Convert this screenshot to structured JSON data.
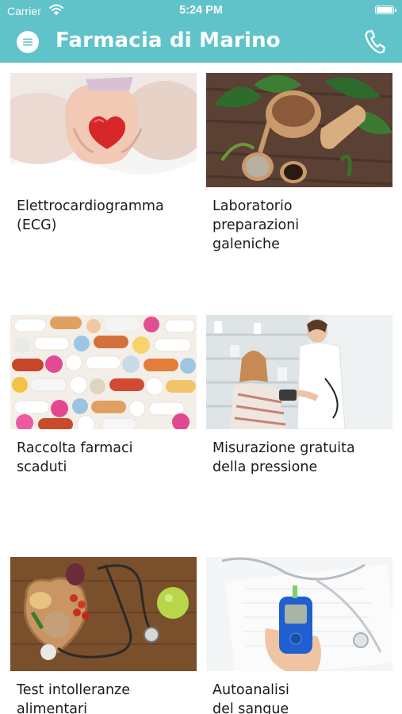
{
  "status_bar": {
    "carrier": "Carrier",
    "time": "5:24 PM",
    "wifi_icon": "wifi-icon",
    "battery_icon": "battery-icon"
  },
  "header": {
    "title": "Farmacia di Marino",
    "menu_icon": "menu-icon",
    "phone_icon": "phone-icon",
    "background": "#5fc3c9"
  },
  "services": [
    {
      "label": "Elettrocardiogramma\n(ECG)",
      "image": "hands-holding-red-heart"
    },
    {
      "label": "Laboratorio\npreparazioni\ngaleniche",
      "image": "herbs-mortar-and-pestle"
    },
    {
      "label": "Raccolta farmaci\nscaduti",
      "image": "colorful-pills-and-capsules"
    },
    {
      "label": "Misurazione gratuita\ndella pressione",
      "image": "pharmacist-measuring-blood-pressure"
    },
    {
      "label": "Test intolleranze\nalimentari",
      "image": "food-and-stethoscope"
    },
    {
      "label": "Autoanalisi\ndel sangue",
      "image": "glucose-meter-in-hand"
    }
  ]
}
